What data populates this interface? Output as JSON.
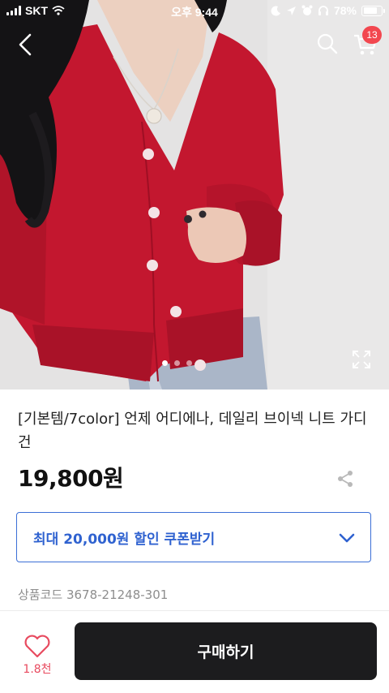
{
  "status_bar": {
    "carrier": "SKT",
    "time": "오후 9:44",
    "battery": "78%",
    "battery_level": 0.78
  },
  "nav": {
    "cart_count": "13"
  },
  "carousel": {
    "total_images": 3,
    "active_index": 0
  },
  "product": {
    "title": "[기본템/7color] 언제 어디에나, 데일리 브이넥 니트 가디건",
    "price": "19,800원",
    "coupon_label": "최대 20,000원 할인 쿠폰받기",
    "code": "상품코드 3678-21248-301"
  },
  "bottom_bar": {
    "like_count": "1.8천",
    "buy_label": "구매하기"
  },
  "colors": {
    "accent_blue": "#2f62d0",
    "badge_red": "#f2474f",
    "like_pink": "#e84a5f",
    "cardigan_red": "#c3172f",
    "buy_button_bg": "#1c1c1e"
  },
  "icons": [
    "back-icon",
    "search-icon",
    "cart-icon",
    "expand-icon",
    "share-icon",
    "chevron-down-icon",
    "heart-icon",
    "wifi-icon",
    "signal-icon",
    "battery-icon",
    "moon-icon",
    "location-icon",
    "alarm-icon",
    "headphones-icon"
  ]
}
